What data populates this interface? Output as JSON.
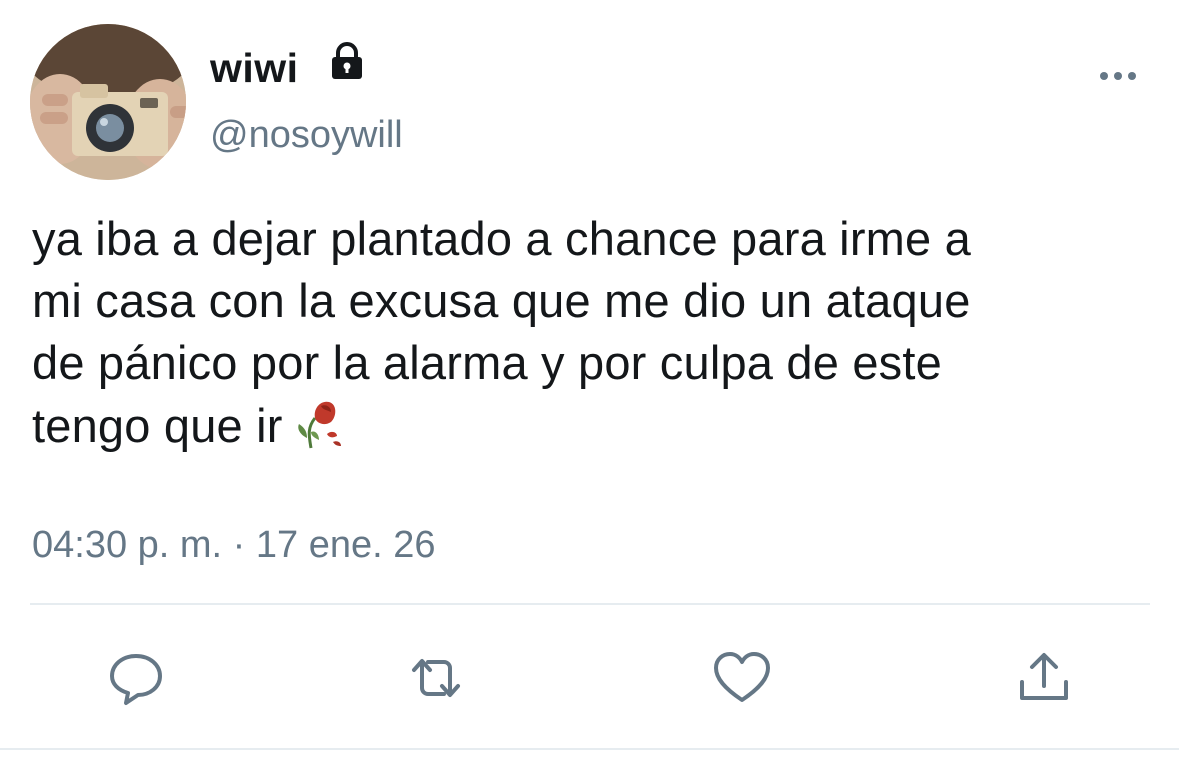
{
  "tweet": {
    "display_name": "wiwi",
    "handle": "@nosoywill",
    "text": "ya iba a dejar plantado a chance para irme a\nmi casa con la excusa que me dio un ataque\nde pánico por la alarma y por culpa de este\ntengo que ir",
    "emoji": "wilted-rose-icon",
    "timestamp": "04:30 p. m. · 17 ene. 26",
    "protected_icon": "lock-icon",
    "more_icon": "more-options-icon"
  },
  "actions": [
    {
      "name": "reply",
      "icon": "comment-icon"
    },
    {
      "name": "retweet",
      "icon": "retweet-icon"
    },
    {
      "name": "like",
      "icon": "heart-icon"
    },
    {
      "name": "share",
      "icon": "share-icon"
    }
  ],
  "colors": {
    "text_primary": "#14171a",
    "text_secondary": "#657786",
    "icon": "#657786",
    "divider": "#e6ecf0",
    "rose": "#c0392b"
  }
}
